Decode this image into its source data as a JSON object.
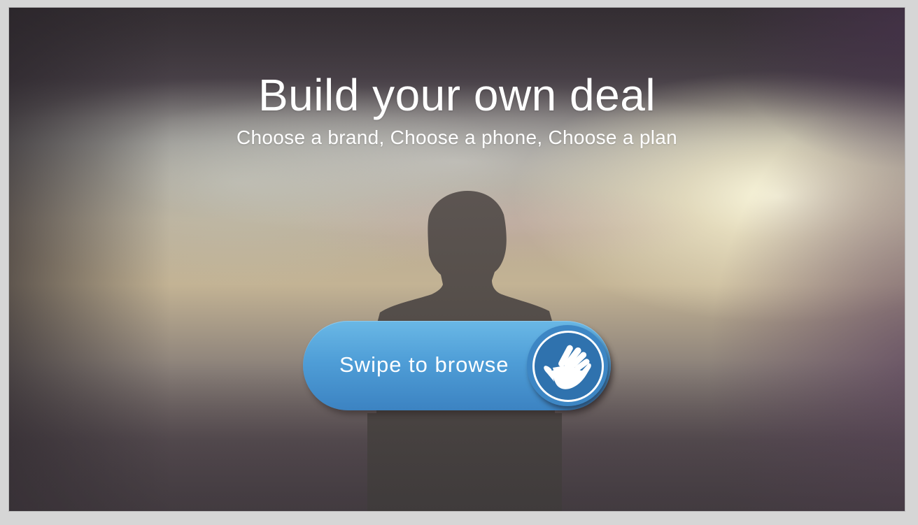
{
  "hero": {
    "title": "Build your own deal",
    "subtitle": "Choose a brand, Choose a phone, Choose a plan"
  },
  "swipe_control": {
    "label": "Swipe to browse",
    "icon": "hand-icon"
  },
  "colors": {
    "button_light": "#6ab8e6",
    "button_dark": "#3c83c2",
    "knob": "#3d86c4",
    "silhouette": "#4a4542"
  }
}
